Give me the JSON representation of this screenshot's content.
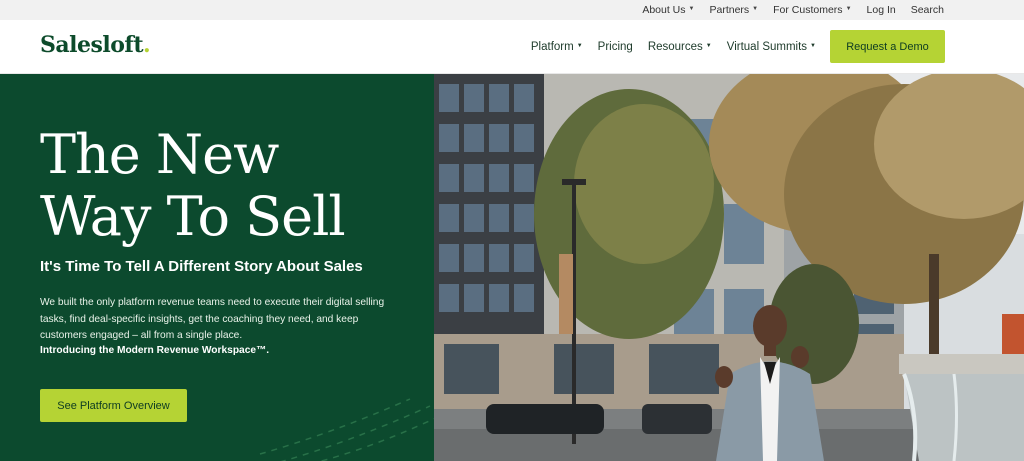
{
  "utility_nav": {
    "items": [
      {
        "label": "About Us",
        "dropdown": true
      },
      {
        "label": "Partners",
        "dropdown": true
      },
      {
        "label": "For Customers",
        "dropdown": true
      },
      {
        "label": "Log In",
        "dropdown": false
      },
      {
        "label": "Search",
        "dropdown": false
      }
    ]
  },
  "header": {
    "logo": "Salesloft",
    "logo_dot": ".",
    "nav": [
      {
        "label": "Platform",
        "dropdown": true
      },
      {
        "label": "Pricing",
        "dropdown": false
      },
      {
        "label": "Resources",
        "dropdown": true
      },
      {
        "label": "Virtual Summits",
        "dropdown": true
      }
    ],
    "cta": "Request a Demo"
  },
  "hero": {
    "title_line1": "The New",
    "title_line2": "Way To Sell",
    "subtitle": "It's Time To Tell A Different Story About Sales",
    "body": "We built the only platform revenue teams need to execute their digital selling tasks, find deal-specific insights, get the coaching they need, and keep customers engaged – all from a single place.",
    "emphasis": "Introducing the Modern Revenue Workspace™.",
    "button": "See Platform Overview"
  },
  "colors": {
    "brand_green": "#0c4a2e",
    "accent_lime": "#b5d334",
    "utility_bg": "#f1f1f1"
  },
  "icons": {
    "dropdown": "caret-down-icon"
  }
}
